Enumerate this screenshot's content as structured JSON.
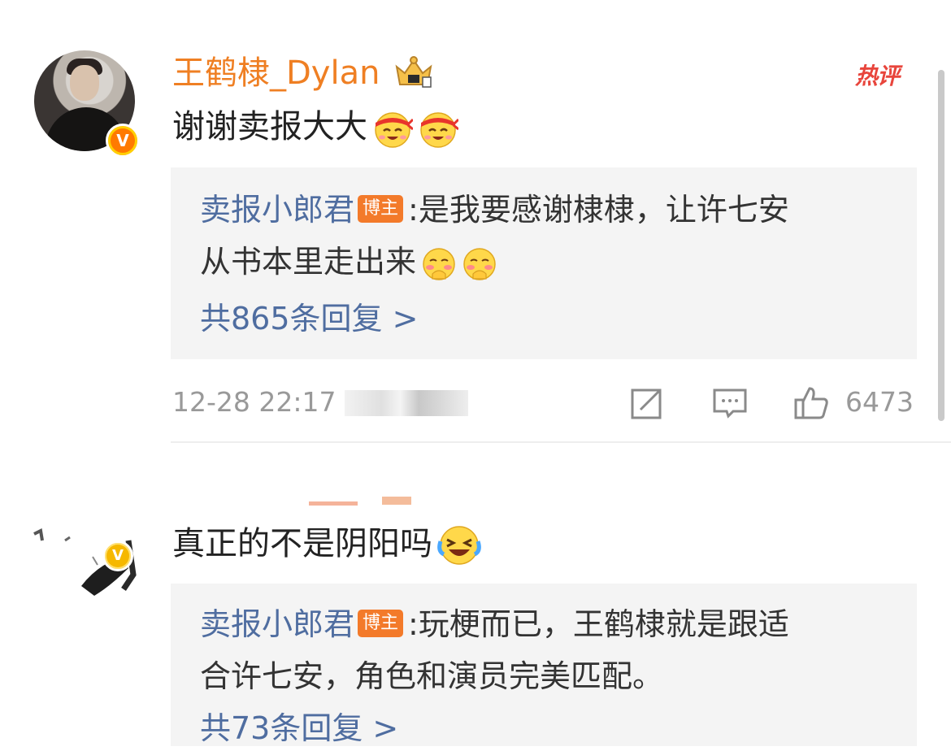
{
  "comments": [
    {
      "username": "王鹤棣_Dylan",
      "hot_label": "热评",
      "verified_mark": "V",
      "text": "谢谢卖报大大",
      "emojis": [
        "headband-smile-emoji",
        "headband-smile-emoji"
      ],
      "reply": {
        "author": "卖报小郎君",
        "badge": "博主",
        "line1": ":是我要感谢棣棣，让许七安",
        "line2": "从书本里走出来",
        "line2_emojis": [
          "shy-face-emoji",
          "shy-face-emoji"
        ],
        "count_text": "共865条回复 >"
      },
      "time": "12-28 22:17",
      "like_count": "6473"
    },
    {
      "verified_mark": "V",
      "text": "真正的不是阴阳吗",
      "emojis": [
        "laughing-tears-emoji"
      ],
      "reply": {
        "author": "卖报小郎君",
        "badge": "博主",
        "line1": ":玩梗而已，王鹤棣就是跟适",
        "line2": "合许七安，角色和演员完美匹配。",
        "count_text": "共73条回复 >"
      }
    }
  ],
  "colors": {
    "username": "#ef7f23",
    "reply_author": "#4f6da0",
    "hot": "#e8453c",
    "badge": "#f37a2a",
    "meta": "#999999",
    "reply_bg": "#f4f4f4"
  },
  "icons": [
    "crown-icon",
    "share-icon",
    "comment-icon",
    "thumbs-up-icon"
  ]
}
